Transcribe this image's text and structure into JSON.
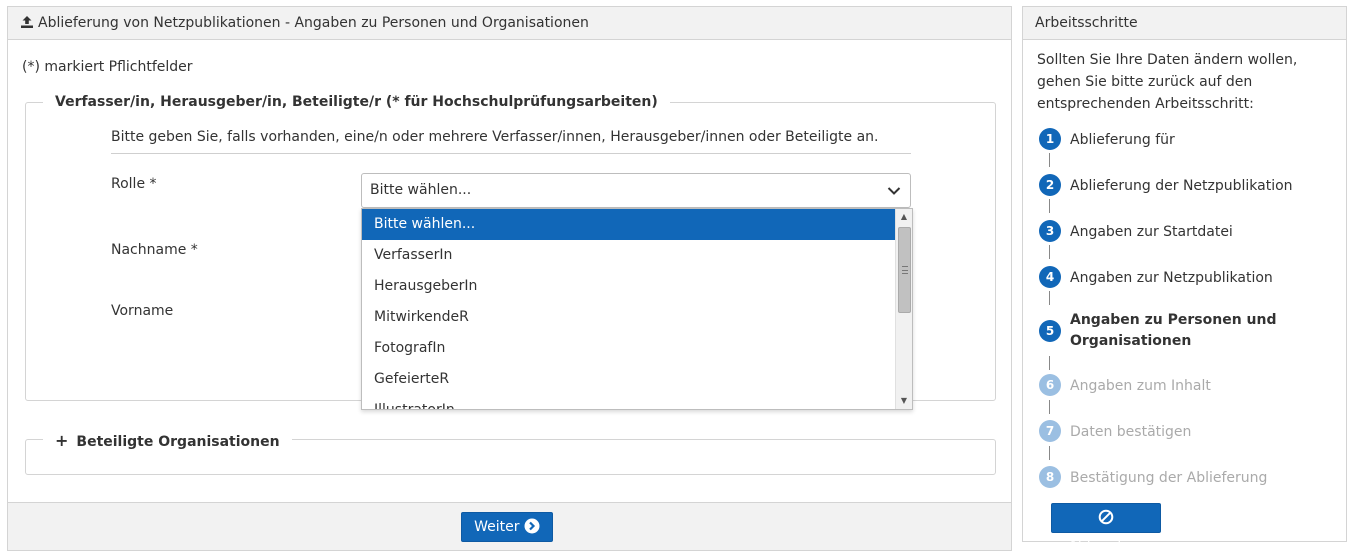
{
  "main_panel": {
    "title": "Ablieferung von Netzpublikationen - Angaben zu Personen und Organisationen",
    "required_note": "(*) markiert Pflichtfelder",
    "persons_group": {
      "legend": "Verfasser/in, Herausgeber/in, Beteiligte/r (* für Hochschulprüfungsarbeiten)",
      "intro": "Bitte geben Sie, falls vorhanden, eine/n oder mehrere Verfasser/innen, Herausgeber/innen oder Beteiligte an.",
      "role_label": "Rolle *",
      "role_selected": "Bitte wählen...",
      "role_options": [
        "Bitte wählen...",
        "VerfasserIn",
        "HerausgeberIn",
        "MitwirkendeR",
        "FotografIn",
        "GefeierteR",
        "IllustratorIn"
      ],
      "lastname_label": "Nachname *",
      "firstname_label": "Vorname"
    },
    "org_group": {
      "expand_icon": "+",
      "legend": "Beteiligte Organisationen"
    },
    "next_button": "Weiter"
  },
  "side_panel": {
    "title": "Arbeitsschritte",
    "text": "Sollten Sie Ihre Daten ändern wollen, gehen Sie bitte zurück auf den entsprechenden Arbeitsschritt:",
    "steps": [
      {
        "num": "1",
        "label": "Ablieferung für",
        "state": "done"
      },
      {
        "num": "2",
        "label": "Ablieferung der Netzpublikation",
        "state": "done"
      },
      {
        "num": "3",
        "label": "Angaben zur Startdatei",
        "state": "done"
      },
      {
        "num": "4",
        "label": "Angaben zur Netzpublikation",
        "state": "done"
      },
      {
        "num": "5",
        "label": "Angaben zu Personen und Organisationen",
        "state": "current"
      },
      {
        "num": "6",
        "label": "Angaben zum Inhalt",
        "state": "future"
      },
      {
        "num": "7",
        "label": "Daten bestätigen",
        "state": "future"
      },
      {
        "num": "8",
        "label": "Bestätigung der Ablieferung",
        "state": "future"
      }
    ],
    "cancel_button": "Abbrechen"
  },
  "colors": {
    "primary": "#1167b8",
    "future_step": "#9bbfe2",
    "panel_header": "#f2f2f2",
    "border": "#d4d4d4"
  }
}
